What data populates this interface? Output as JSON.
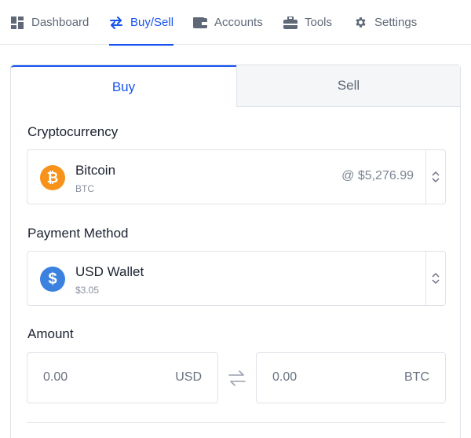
{
  "nav": {
    "items": [
      {
        "label": "Dashboard",
        "icon": "dashboard-icon"
      },
      {
        "label": "Buy/Sell",
        "icon": "swap-arrows-icon",
        "active": true
      },
      {
        "label": "Accounts",
        "icon": "wallet-icon"
      },
      {
        "label": "Tools",
        "icon": "toolbox-icon"
      },
      {
        "label": "Settings",
        "icon": "gear-icon"
      }
    ]
  },
  "tabs": {
    "buy": "Buy",
    "sell": "Sell"
  },
  "crypto": {
    "label": "Cryptocurrency",
    "name": "Bitcoin",
    "symbol": "BTC",
    "price": "@ $5,276.99",
    "icon_glyph": "₿",
    "color": "#f7931a"
  },
  "payment": {
    "label": "Payment Method",
    "name": "USD Wallet",
    "balance": "$3.05",
    "icon_glyph": "$",
    "color": "#3b82e0"
  },
  "amount": {
    "label": "Amount",
    "usd_value": "0.00",
    "usd_currency": "USD",
    "btc_value": "0.00",
    "btc_currency": "BTC"
  },
  "colors": {
    "accent": "#1652f0",
    "border": "#dfe3e8"
  }
}
